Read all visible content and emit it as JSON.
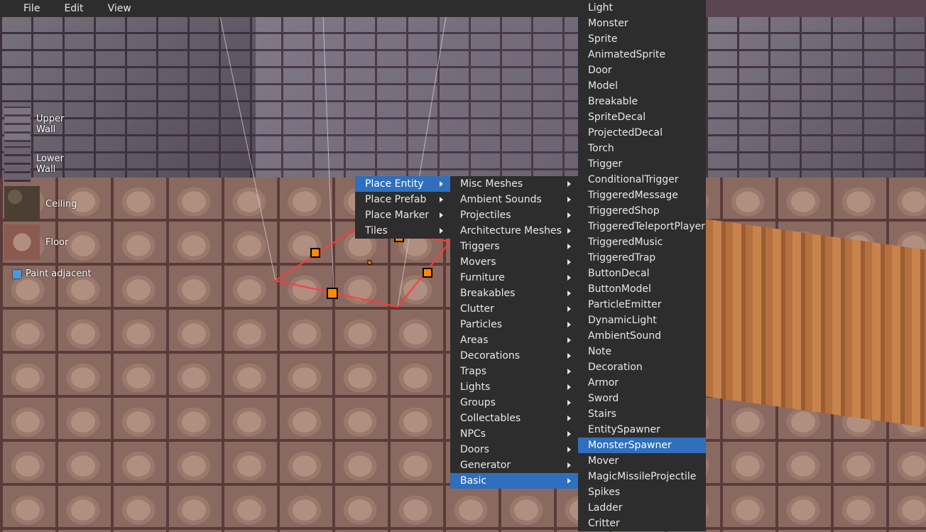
{
  "menubar": {
    "items": [
      "File",
      "Edit",
      "View"
    ]
  },
  "palette": {
    "upper_wall": "Upper Wall",
    "lower_wall": "Lower Wall",
    "ceiling": "Ceiling",
    "floor": "Floor",
    "paint_adjacent": "Paint adjacent"
  },
  "context_menu": {
    "items": [
      {
        "label": "Place Entity",
        "selected": true
      },
      {
        "label": "Place Prefab"
      },
      {
        "label": "Place Marker"
      },
      {
        "label": "Tiles"
      }
    ]
  },
  "entity_categories": {
    "items": [
      "Misc Meshes",
      "Ambient Sounds",
      "Projectiles",
      "Architecture Meshes",
      "Triggers",
      "Movers",
      "Furniture",
      "Breakables",
      "Clutter",
      "Particles",
      "Areas",
      "Decorations",
      "Traps",
      "Lights",
      "Groups",
      "Collectables",
      "NPCs",
      "Doors",
      "Generator",
      "Basic"
    ],
    "selected": "Basic"
  },
  "basic_entities": {
    "items": [
      "Light",
      "Monster",
      "Sprite",
      "AnimatedSprite",
      "Door",
      "Model",
      "Breakable",
      "SpriteDecal",
      "ProjectedDecal",
      "Torch",
      "Trigger",
      "ConditionalTrigger",
      "TriggeredMessage",
      "TriggeredShop",
      "TriggeredTeleportPlayer",
      "TriggeredMusic",
      "TriggeredTrap",
      "ButtonDecal",
      "ButtonModel",
      "ParticleEmitter",
      "DynamicLight",
      "AmbientSound",
      "Note",
      "Decoration",
      "Armor",
      "Sword",
      "Stairs",
      "EntitySpawner",
      "MonsterSpawner",
      "Mover",
      "MagicMissileProjectile",
      "Spikes",
      "Ladder",
      "Critter"
    ],
    "selected": "MonsterSpawner"
  },
  "colors": {
    "menu_bg": "#2d2d2d",
    "highlight": "#2f6fbd",
    "selection_outline": "#ff3b3b"
  }
}
